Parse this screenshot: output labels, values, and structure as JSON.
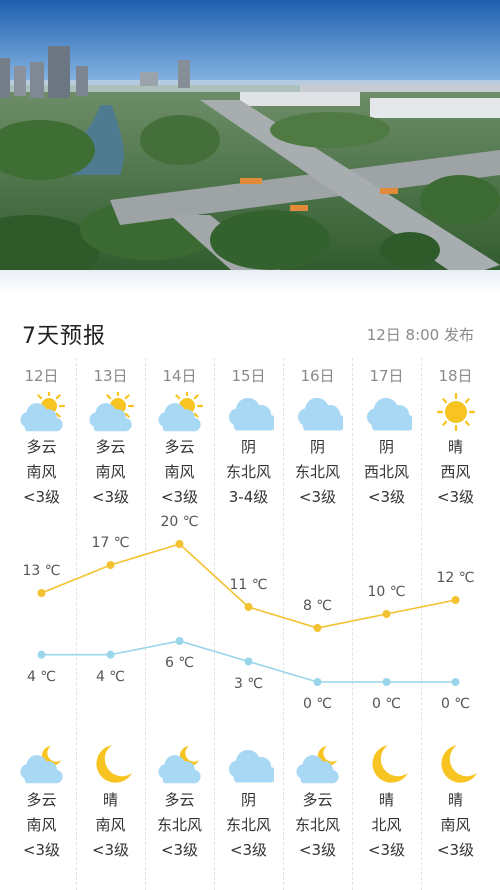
{
  "header": {
    "title": "7天预报",
    "publish_time": "12日 8:00 发布"
  },
  "colors": {
    "high_line": "#f2c230",
    "low_line": "#9ad6ea",
    "sun": "#f7c421",
    "cloud": "#a9d8f5",
    "moon": "#f7c421"
  },
  "days": [
    {
      "date": "12日",
      "day": {
        "icon": "partly-cloudy-day-icon",
        "weather": "多云",
        "wind_dir": "南风",
        "wind_level": "<3级"
      },
      "high": "13 ℃",
      "low": "4 ℃",
      "night": {
        "icon": "partly-cloudy-night-icon",
        "weather": "多云",
        "wind_dir": "南风",
        "wind_level": "<3级"
      }
    },
    {
      "date": "13日",
      "day": {
        "icon": "partly-cloudy-day-icon",
        "weather": "多云",
        "wind_dir": "南风",
        "wind_level": "<3级"
      },
      "high": "17 ℃",
      "low": "4 ℃",
      "night": {
        "icon": "moon-icon",
        "weather": "晴",
        "wind_dir": "南风",
        "wind_level": "<3级"
      }
    },
    {
      "date": "14日",
      "day": {
        "icon": "partly-cloudy-day-icon",
        "weather": "多云",
        "wind_dir": "南风",
        "wind_level": "<3级"
      },
      "high": "20 ℃",
      "low": "6 ℃",
      "night": {
        "icon": "partly-cloudy-night-icon",
        "weather": "多云",
        "wind_dir": "东北风",
        "wind_level": "<3级"
      }
    },
    {
      "date": "15日",
      "day": {
        "icon": "cloud-icon",
        "weather": "阴",
        "wind_dir": "东北风",
        "wind_level": "3-4级"
      },
      "high": "11 ℃",
      "low": "3 ℃",
      "night": {
        "icon": "cloud-icon",
        "weather": "阴",
        "wind_dir": "东北风",
        "wind_level": "<3级"
      }
    },
    {
      "date": "16日",
      "day": {
        "icon": "cloud-icon",
        "weather": "阴",
        "wind_dir": "东北风",
        "wind_level": "<3级"
      },
      "high": "8 ℃",
      "low": "0 ℃",
      "night": {
        "icon": "partly-cloudy-night-icon",
        "weather": "多云",
        "wind_dir": "东北风",
        "wind_level": "<3级"
      }
    },
    {
      "date": "17日",
      "day": {
        "icon": "cloud-icon",
        "weather": "阴",
        "wind_dir": "西北风",
        "wind_level": "<3级"
      },
      "high": "10 ℃",
      "low": "0 ℃",
      "night": {
        "icon": "moon-icon",
        "weather": "晴",
        "wind_dir": "北风",
        "wind_level": "<3级"
      }
    },
    {
      "date": "18日",
      "day": {
        "icon": "sun-icon",
        "weather": "晴",
        "wind_dir": "西风",
        "wind_level": "<3级"
      },
      "high": "12 ℃",
      "low": "0 ℃",
      "night": {
        "icon": "moon-icon",
        "weather": "晴",
        "wind_dir": "南风",
        "wind_level": "<3级"
      }
    }
  ],
  "high_values": [
    13,
    17,
    20,
    11,
    8,
    10,
    12
  ],
  "low_values": [
    4,
    4,
    6,
    3,
    0,
    0,
    0
  ]
}
